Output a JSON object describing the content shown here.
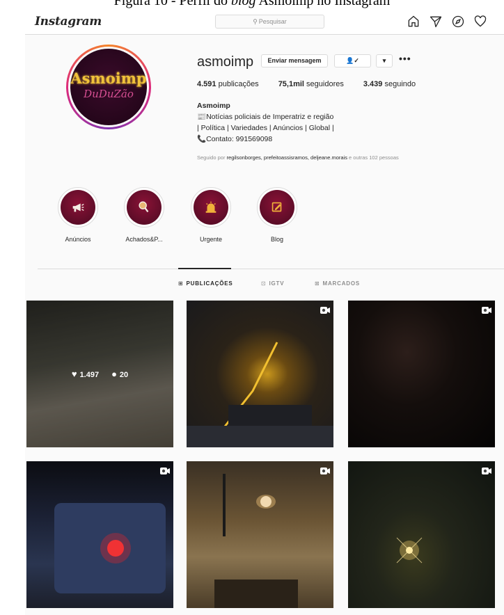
{
  "caption": {
    "prefix": "Figura 10 - Perfil do ",
    "italic": "blog",
    "suffix": " Asmoimp no Instagram"
  },
  "topbar": {
    "logo": "Instagram",
    "search_placeholder": "Pesquisar",
    "icons": [
      "home-icon",
      "direct-icon",
      "explore-icon",
      "activity-heart-icon"
    ]
  },
  "profile": {
    "username": "asmoimp",
    "avatar_text": "Asmoimp",
    "avatar_subtext": "DuDuZão",
    "message_button": "Enviar mensagem",
    "follow_button_icon": "person-check-icon",
    "dropdown_icon": "caret-down-icon",
    "more": "•••",
    "stats": {
      "posts_value": "4.591",
      "posts_label": " publicações",
      "followers_value": "75,1mil",
      "followers_label": " seguidores",
      "following_value": "3.439",
      "following_label": " seguindo"
    },
    "bio": {
      "name": "Asmoimp",
      "line1": "📰Notícias policiais de Imperatriz e região",
      "line2": "| Política | Variedades | Anúncios | Global |",
      "line3": "📞Contato: 991569098"
    },
    "followed_by": {
      "prefix": "Seguido por ",
      "users": "regilsonborges, prefeitoassisramos, deljeane.morais",
      "suffix": " e outras 102 pessoas"
    }
  },
  "highlights": [
    {
      "label": "Anúncios",
      "icon": "megaphone-icon"
    },
    {
      "label": "Achados&P...",
      "icon": "magnifier-icon"
    },
    {
      "label": "Urgente",
      "icon": "siren-icon"
    },
    {
      "label": "Blog",
      "icon": "edit-note-icon"
    }
  ],
  "tabs": [
    {
      "label": "PUBLICAÇÕES",
      "icon": "⊞",
      "active": true
    },
    {
      "label": "IGTV",
      "icon": "⊡",
      "active": false
    },
    {
      "label": "MARCADOS",
      "icon": "⊠",
      "active": false
    }
  ],
  "posts": [
    {
      "likes": "1.497",
      "comments": "20",
      "hovered": true
    },
    {
      "video": true
    },
    {
      "video": true
    },
    {
      "video": true
    },
    {
      "video": true
    },
    {
      "video": true
    }
  ]
}
